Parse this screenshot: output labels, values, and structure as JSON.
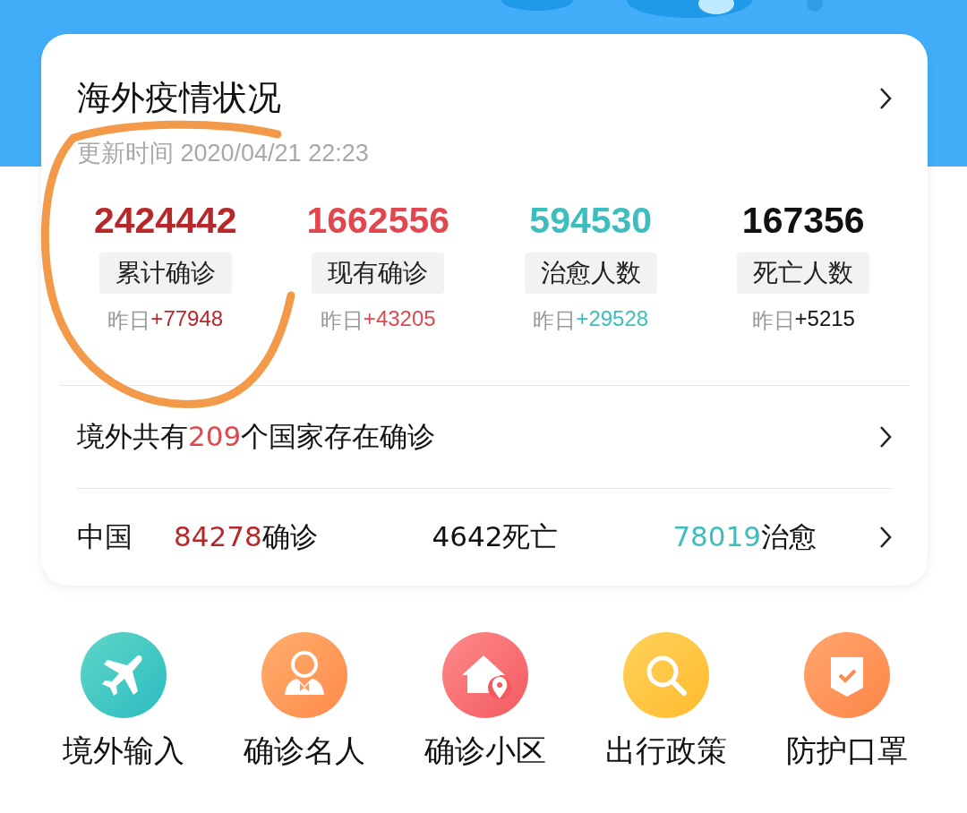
{
  "header": {
    "kind": "banner"
  },
  "card": {
    "title": "海外疫情状况",
    "updated": "更新时间 2020/04/21 22:23",
    "stats": [
      {
        "value": "2424442",
        "label": "累计确诊",
        "yesterday_label": "昨日",
        "delta": "+77948",
        "color": "#b8282a"
      },
      {
        "value": "1662556",
        "label": "现有确诊",
        "yesterday_label": "昨日",
        "delta": "+43205",
        "color": "#e0474f"
      },
      {
        "value": "594530",
        "label": "治愈人数",
        "yesterday_label": "昨日",
        "delta": "+29528",
        "color": "#3dbdbd"
      },
      {
        "value": "167356",
        "label": "死亡人数",
        "yesterday_label": "昨日",
        "delta": "+5215",
        "color": "#111111"
      }
    ],
    "countries": {
      "prefix": "境外共有",
      "count": "209",
      "suffix": "个国家存在确诊"
    },
    "china": {
      "country": "中国",
      "figures": [
        {
          "number": "84278",
          "unit": "确诊",
          "color": "#b8282a"
        },
        {
          "number": "4642",
          "unit": "死亡",
          "color": "#111111"
        },
        {
          "number": "78019",
          "unit": "治愈",
          "color": "#3dbdbd"
        }
      ]
    }
  },
  "shortcuts": [
    {
      "label": "境外输入",
      "kind": "plane"
    },
    {
      "label": "确诊名人",
      "kind": "person"
    },
    {
      "label": "确诊小区",
      "kind": "house"
    },
    {
      "label": "出行政策",
      "kind": "search"
    },
    {
      "label": "防护口罩",
      "kind": "shield"
    }
  ],
  "annotation": {
    "kind": "circle"
  }
}
